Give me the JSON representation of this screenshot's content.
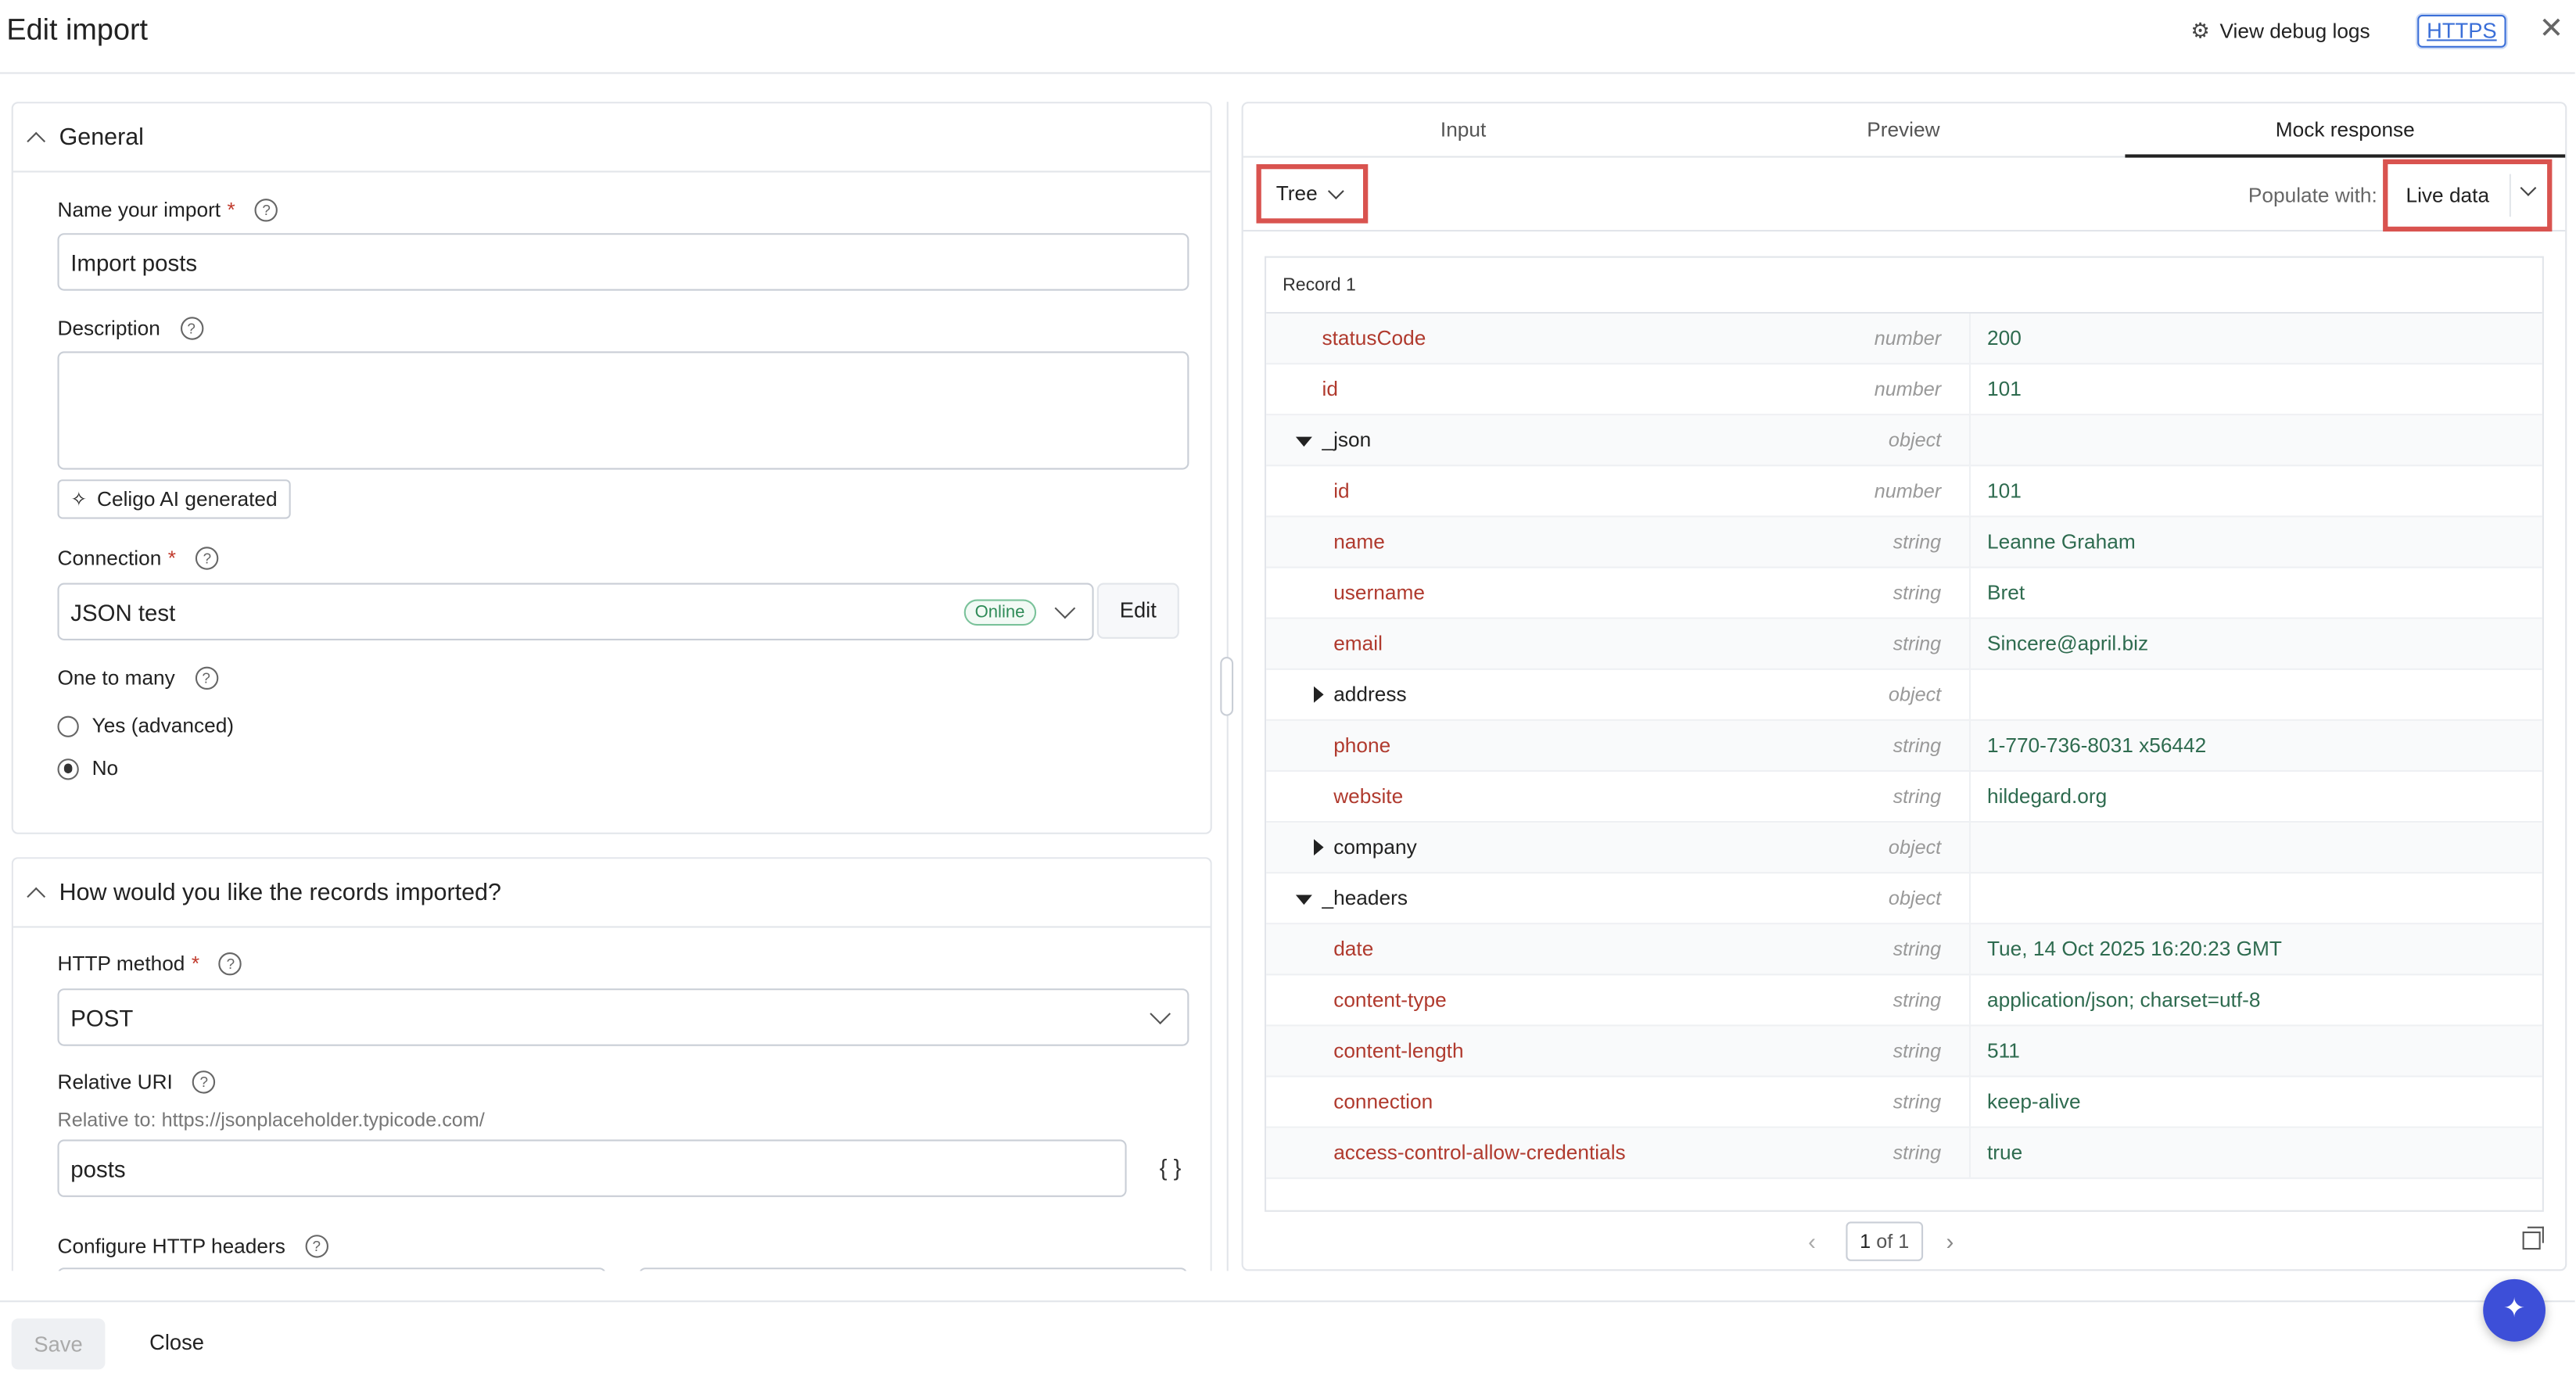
{
  "header": {
    "title": "Edit import",
    "debug_label": "View debug logs",
    "https_label": "HTTPS",
    "close_glyph": "✕"
  },
  "general": {
    "title": "General",
    "name_label": "Name your import",
    "name_value": "Import posts",
    "description_label": "Description",
    "description_value": "",
    "ai_button": "Celigo AI generated",
    "connection_label": "Connection",
    "connection_value": "JSON test",
    "connection_status": "Online",
    "edit_button": "Edit",
    "one_to_many_label": "One to many",
    "radio_yes": "Yes (advanced)",
    "radio_no": "No",
    "selected_radio": "No"
  },
  "records": {
    "title": "How would you like the records imported?",
    "http_method_label": "HTTP method",
    "http_method_value": "POST",
    "relative_uri_label": "Relative URI",
    "relative_to": "Relative to: https://jsonplaceholder.typicode.com/",
    "relative_uri_value": "posts",
    "braces": "{ }",
    "headers_label": "Configure HTTP headers"
  },
  "right": {
    "tabs": [
      "Input",
      "Preview",
      "Mock response"
    ],
    "active_tab": "Mock response",
    "view_mode": "Tree",
    "populate_label": "Populate with:",
    "populate_value": "Live data",
    "record_title": "Record 1",
    "rows": [
      {
        "key": "statusCode",
        "type": "number",
        "value": "200",
        "level": 0,
        "kind": "leaf"
      },
      {
        "key": "id",
        "type": "number",
        "value": "101",
        "level": 0,
        "kind": "leaf"
      },
      {
        "key": "_json",
        "type": "object",
        "value": "",
        "level": 0,
        "kind": "open"
      },
      {
        "key": "id",
        "type": "number",
        "value": "101",
        "level": 1,
        "kind": "leaf"
      },
      {
        "key": "name",
        "type": "string",
        "value": "Leanne Graham",
        "level": 1,
        "kind": "leaf"
      },
      {
        "key": "username",
        "type": "string",
        "value": "Bret",
        "level": 1,
        "kind": "leaf"
      },
      {
        "key": "email",
        "type": "string",
        "value": "Sincere@april.biz",
        "level": 1,
        "kind": "leaf"
      },
      {
        "key": "address",
        "type": "object",
        "value": "",
        "level": 1,
        "kind": "closed"
      },
      {
        "key": "phone",
        "type": "string",
        "value": "1-770-736-8031 x56442",
        "level": 1,
        "kind": "leaf"
      },
      {
        "key": "website",
        "type": "string",
        "value": "hildegard.org",
        "level": 1,
        "kind": "leaf"
      },
      {
        "key": "company",
        "type": "object",
        "value": "",
        "level": 1,
        "kind": "closed"
      },
      {
        "key": "_headers",
        "type": "object",
        "value": "",
        "level": 0,
        "kind": "open"
      },
      {
        "key": "date",
        "type": "string",
        "value": "Tue, 14 Oct 2025 16:20:23 GMT",
        "level": 1,
        "kind": "leaf"
      },
      {
        "key": "content-type",
        "type": "string",
        "value": "application/json; charset=utf-8",
        "level": 1,
        "kind": "leaf"
      },
      {
        "key": "content-length",
        "type": "string",
        "value": "511",
        "level": 1,
        "kind": "leaf"
      },
      {
        "key": "connection",
        "type": "string",
        "value": "keep-alive",
        "level": 1,
        "kind": "leaf"
      },
      {
        "key": "access-control-allow-credentials",
        "type": "string",
        "value": "true",
        "level": 1,
        "kind": "leaf"
      }
    ],
    "pager": {
      "current": "1",
      "of_text": "of 1"
    }
  },
  "footer": {
    "save_label": "Save",
    "close_label": "Close"
  },
  "icons": {
    "debug": "gear-icon",
    "ai": "sparkle-icon",
    "fab": "sparkle-icon"
  }
}
